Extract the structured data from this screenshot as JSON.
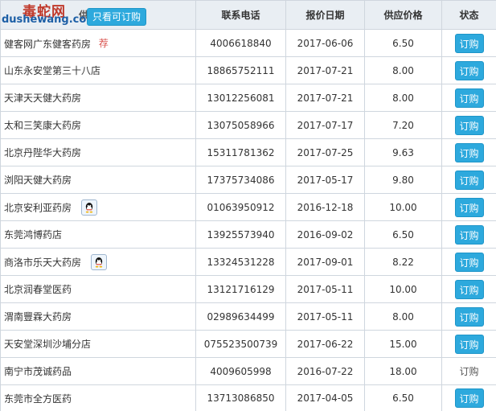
{
  "header": {
    "col_store": "供应商家",
    "col_phone": "联系电话",
    "col_date": "报价日期",
    "col_price": "供应价格",
    "col_status": "状态",
    "filter_button": "只看可订购"
  },
  "watermark": {
    "top": "毒蛇网",
    "bottom": "dushewang.com"
  },
  "colors": {
    "accent": "#2da9dd",
    "header_bg": "#e9eef3",
    "recommend": "#d9534f"
  },
  "rows": [
    {
      "store": "健客网广东健客药房",
      "badge": "荐",
      "qq": false,
      "phone": "4006618840",
      "date": "2017-06-06",
      "price": "6.50",
      "status": "订购",
      "active": true
    },
    {
      "store": "山东永安堂第三十八店",
      "badge": "",
      "qq": false,
      "phone": "18865752111",
      "date": "2017-07-21",
      "price": "8.00",
      "status": "订购",
      "active": true
    },
    {
      "store": "天津天天健大药房",
      "badge": "",
      "qq": false,
      "phone": "13012256081",
      "date": "2017-07-21",
      "price": "8.00",
      "status": "订购",
      "active": true
    },
    {
      "store": "太和三笑康大药房",
      "badge": "",
      "qq": false,
      "phone": "13075058966",
      "date": "2017-07-17",
      "price": "7.20",
      "status": "订购",
      "active": true
    },
    {
      "store": "北京丹陛华大药房",
      "badge": "",
      "qq": false,
      "phone": "15311781362",
      "date": "2017-07-25",
      "price": "9.63",
      "status": "订购",
      "active": true
    },
    {
      "store": "浏阳天健大药房",
      "badge": "",
      "qq": false,
      "phone": "17375734086",
      "date": "2017-05-17",
      "price": "9.80",
      "status": "订购",
      "active": true
    },
    {
      "store": "北京安利亚药房",
      "badge": "",
      "qq": true,
      "phone": "01063950912",
      "date": "2016-12-18",
      "price": "10.00",
      "status": "订购",
      "active": true
    },
    {
      "store": "东莞鸿博药店",
      "badge": "",
      "qq": false,
      "phone": "13925573940",
      "date": "2016-09-02",
      "price": "6.50",
      "status": "订购",
      "active": true
    },
    {
      "store": "商洛市乐天大药房",
      "badge": "",
      "qq": true,
      "phone": "13324531228",
      "date": "2017-09-01",
      "price": "8.22",
      "status": "订购",
      "active": true
    },
    {
      "store": "北京润春堂医药",
      "badge": "",
      "qq": false,
      "phone": "13121716129",
      "date": "2017-05-11",
      "price": "10.00",
      "status": "订购",
      "active": true
    },
    {
      "store": "渭南豐霖大药房",
      "badge": "",
      "qq": false,
      "phone": "02989634499",
      "date": "2017-05-11",
      "price": "8.00",
      "status": "订购",
      "active": true
    },
    {
      "store": "天安堂深圳沙埔分店",
      "badge": "",
      "qq": false,
      "phone": "075523500739",
      "date": "2017-06-22",
      "price": "15.00",
      "status": "订购",
      "active": true
    },
    {
      "store": "南宁市茂诚药品",
      "badge": "",
      "qq": false,
      "phone": "4009605998",
      "date": "2016-07-22",
      "price": "18.00",
      "status": "订购",
      "active": false
    },
    {
      "store": "东莞市全方医药",
      "badge": "",
      "qq": false,
      "phone": "13713086850",
      "date": "2017-04-05",
      "price": "6.50",
      "status": "订购",
      "active": true
    }
  ]
}
